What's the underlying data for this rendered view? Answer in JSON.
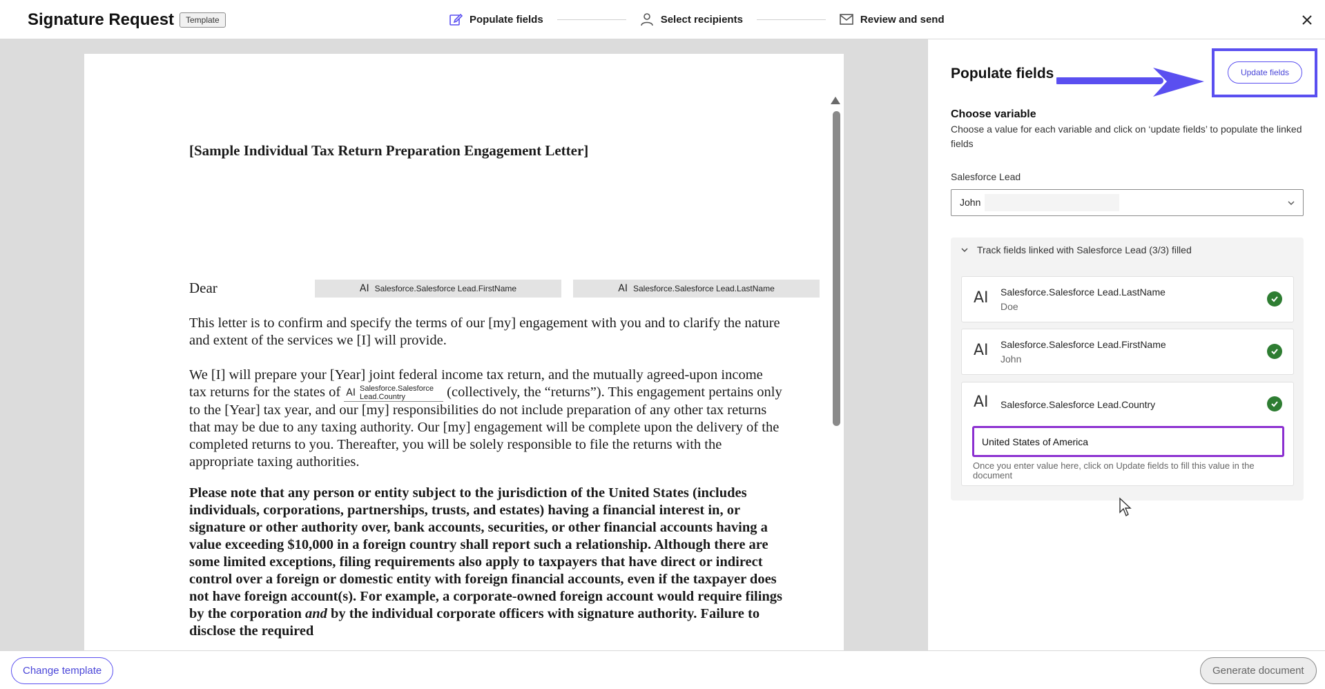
{
  "header": {
    "title": "Signature Request",
    "badge": "Template",
    "steps": [
      {
        "label": "Populate fields",
        "icon": "edit-icon"
      },
      {
        "label": "Select recipients",
        "icon": "person-icon"
      },
      {
        "label": "Review and send",
        "icon": "envelope-icon"
      }
    ],
    "close_icon": "close-icon"
  },
  "document": {
    "heading": "[Sample Individual Tax Return Preparation Engagement Letter]",
    "dear": "Dear",
    "field_icon": "AI",
    "firstname_field": "Salesforce.Salesforce Lead.FirstName",
    "lastname_field": "Salesforce.Salesforce Lead.LastName",
    "para1": "This letter is to confirm and specify the terms of our [my] engagement with you and to clarify the nature and extent of the services we [I] will provide.",
    "para2_before": "We [I] will prepare your [Year] joint federal income tax return, and the mutually agreed-upon income tax returns for the states of",
    "country_field_line1": "Salesforce.Salesforce",
    "country_field_line2": "Lead.Country",
    "para2_after": "(collectively, the “returns”).  This engagement pertains only to the [Year] tax year, and our [my] responsibilities do not include preparation of any other tax returns that may be due to any taxing authority.  Our [my] engagement will be complete upon the delivery of the completed returns to you.  Thereafter, you will be solely responsible to file the returns with the appropriate taxing authorities.",
    "para3_before": "Please note that any person or entity subject to the jurisdiction of the United States (includes individuals, corporations, partnerships, trusts, and estates) having a financial interest in, or signature or other authority over, bank accounts, securities, or other financial accounts having a value exceeding $10,000 in a foreign country shall report such a relationship. Although there are some limited exceptions, filing requirements also apply to taxpayers that have direct or indirect control over a foreign or domestic entity with foreign financial accounts, even if the taxpayer does not have foreign account(s). For example, a corporate-owned foreign account would require filings by the corporation",
    "para3_italic": "and",
    "para3_after": "by the individual corporate officers with signature authority. Failure to disclose the required"
  },
  "panel": {
    "title": "Populate fields",
    "update_button": "Update fields",
    "choose_label": "Choose variable",
    "choose_desc": "Choose a value for each variable and click on ‘update fields’ to populate the linked fields",
    "lead_label": "Salesforce Lead",
    "lead_value": "John",
    "track_header": "Track fields linked with Salesforce Lead (3/3) filled",
    "fields": [
      {
        "name": "Salesforce.Salesforce Lead.LastName",
        "value": "Doe"
      },
      {
        "name": "Salesforce.Salesforce Lead.FirstName",
        "value": "John"
      },
      {
        "name": "Salesforce.Salesforce Lead.Country",
        "value": ""
      }
    ],
    "country_input_value": "United States of America",
    "country_hint": "Once you enter value here, click on Update fields to fill this value in the document"
  },
  "footer": {
    "change_template": "Change template",
    "generate_document": "Generate document"
  },
  "colors": {
    "accent": "#5a4ff0",
    "focus": "#8b2fd0",
    "success": "#2e7d32"
  }
}
